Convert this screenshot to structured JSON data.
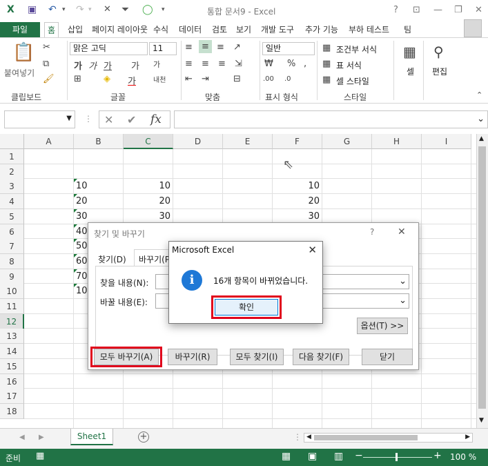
{
  "title_bar": {
    "title": "통합 문서9 - Excel",
    "help": "?",
    "ribbon_display": "⊡",
    "minimize": "—",
    "restore": "❐",
    "close": "✕"
  },
  "ribbon_tabs": {
    "file": "파일",
    "items": [
      "홈",
      "삽입",
      "페이지 레이아웃",
      "수식",
      "데이터",
      "검토",
      "보기",
      "개발 도구",
      "추가 기능",
      "부하 테스트",
      "팀"
    ]
  },
  "ribbon": {
    "paste_label": "붙여넣기",
    "font_name": "맑은 고딕",
    "font_size": "11",
    "number_format": "일반",
    "conditional_format": "조건부 서식",
    "format_as_table": "표 서식",
    "cell_styles": "셀 스타일",
    "cells_label": "셀",
    "editing_label": "편집",
    "wrap_label": "내천",
    "groups": {
      "clipboard": "클립보드",
      "font": "글꼴",
      "alignment": "맞춤",
      "number": "표시 형식",
      "styles": "스타일"
    }
  },
  "formula_bar": {
    "fx": "fx",
    "cancel": "✕",
    "enter": "✔"
  },
  "grid": {
    "columns": [
      "A",
      "B",
      "C",
      "D",
      "E",
      "F",
      "G",
      "H",
      "I"
    ],
    "rows": [
      "1",
      "2",
      "3",
      "4",
      "5",
      "6",
      "7",
      "8",
      "9",
      "10",
      "11",
      "12",
      "13",
      "14",
      "15",
      "16",
      "17",
      "18"
    ],
    "col_b": [
      "10",
      "20",
      "30",
      "40",
      "50",
      "60",
      "70",
      "100"
    ],
    "col_c": [
      "10",
      "20",
      "30"
    ],
    "col_f": [
      "10",
      "20",
      "30"
    ]
  },
  "sheet_tabs": {
    "sheet1": "Sheet1",
    "add": "+"
  },
  "status_bar": {
    "ready": "준비",
    "zoom": "100 %"
  },
  "find_replace": {
    "title": "찾기 및 바꾸기",
    "help": "?",
    "close": "✕",
    "tab_find": "찾기(D)",
    "tab_replace": "바꾸기(P)",
    "find_label": "찾을 내용(N):",
    "replace_label": "바꿀 내용(E):",
    "options_button": "옵션(T) >>",
    "replace_all": "모두 바꾸기(A)",
    "replace": "바꾸기(R)",
    "find_all": "모두 찾기(I)",
    "find_next": "다음 찾기(F)",
    "close_button": "닫기"
  },
  "message_box": {
    "title": "Microsoft Excel",
    "close": "✕",
    "icon": "i",
    "message": "16개 항목이 바뀌었습니다.",
    "ok_button": "확인"
  }
}
